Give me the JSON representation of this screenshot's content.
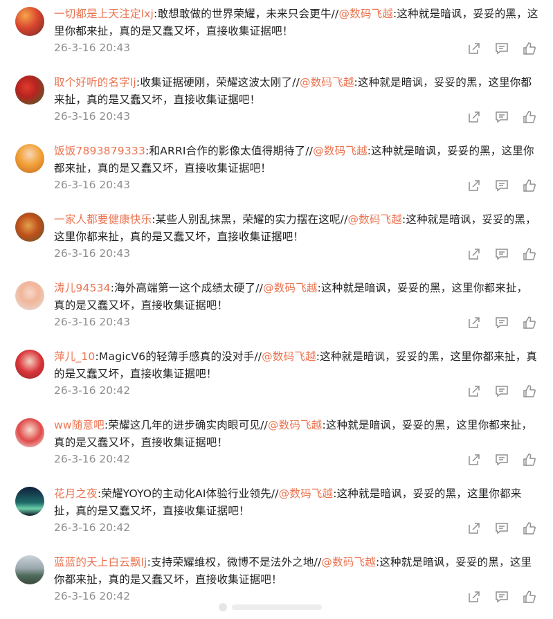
{
  "colors": {
    "accent": "#eb7350",
    "text": "#222222",
    "meta": "#8f8f8f"
  },
  "icons": {
    "share": "share-icon",
    "comment": "comment-icon",
    "like": "like-icon"
  },
  "comments": [
    {
      "user": "一切都是上天注定lxj",
      "sep": ":",
      "body": "敢想敢做的世界荣耀，未来只会更牛//",
      "mention": "@数码飞越",
      "quote": ":这种就是暗讽，妥妥的黑，这里你都来扯，真的是又蠢又坏，直接收集证据吧！",
      "time": "26-3-16 20:43"
    },
    {
      "user": "取个好听的名字lj",
      "sep": ":",
      "body": "收集证据硬刚，荣耀这波太刚了//",
      "mention": "@数码飞越",
      "quote": ":这种就是暗讽，妥妥的黑，这里你都来扯，真的是又蠢又坏，直接收集证据吧！",
      "time": "26-3-16 20:43"
    },
    {
      "user": "饭饭7893879333",
      "sep": ":",
      "body": "和ARRI合作的影像太值得期待了//",
      "mention": "@数码飞越",
      "quote": ":这种就是暗讽，妥妥的黑，这里你都来扯，真的是又蠢又坏，直接收集证据吧！",
      "time": "26-3-16 20:43"
    },
    {
      "user": "一家人都要健康快乐",
      "sep": ":",
      "body": "某些人别乱抹黑，荣耀的实力摆在这呢//",
      "mention": "@数码飞越",
      "quote": ":这种就是暗讽，妥妥的黑，这里你都来扯，真的是又蠢又坏，直接收集证据吧！",
      "time": "26-3-16 20:43"
    },
    {
      "user": "涛儿94534",
      "sep": ":",
      "body": "海外高端第一这个成绩太硬了//",
      "mention": "@数码飞越",
      "quote": ":这种就是暗讽，妥妥的黑，这里你都来扯，真的是又蠢又坏，直接收集证据吧！",
      "time": "26-3-16 20:43"
    },
    {
      "user": "萍儿_10",
      "sep": ":",
      "body": "MagicV6的轻薄手感真的没对手//",
      "mention": "@数码飞越",
      "quote": ":这种就是暗讽，妥妥的黑，这里你都来扯，真的是又蠢又坏，直接收集证据吧！",
      "time": "26-3-16 20:42"
    },
    {
      "user": "ww随意吧",
      "sep": ":",
      "body": "荣耀这几年的进步确实肉眼可见//",
      "mention": "@数码飞越",
      "quote": ":这种就是暗讽，妥妥的黑，这里你都来扯，真的是又蠢又坏，直接收集证据吧！",
      "time": "26-3-16 20:42"
    },
    {
      "user": "花月之夜",
      "sep": ":",
      "body": "荣耀YOYO的主动化AI体验行业领先//",
      "mention": "@数码飞越",
      "quote": ":这种就是暗讽，妥妥的黑，这里你都来扯，真的是又蠢又坏，直接收集证据吧！",
      "time": "26-3-16 20:42"
    },
    {
      "user": "蓝蓝的天上白云飘lj",
      "sep": ":",
      "body": "支持荣耀维权，微博不是法外之地//",
      "mention": "@数码飞越",
      "quote": ":这种就是暗讽，妥妥的黑，这里你都来扯，真的是又蠢又坏，直接收集证据吧！",
      "time": "26-3-16 20:42"
    }
  ]
}
